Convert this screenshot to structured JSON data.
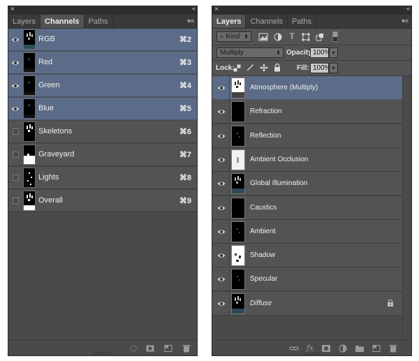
{
  "channels_panel": {
    "close_glyph": "×",
    "collapse_glyph": "«",
    "menu_glyph": "▾≡",
    "tabs": [
      {
        "label": "Layers",
        "active": false
      },
      {
        "label": "Channels",
        "active": true
      },
      {
        "label": "Paths",
        "active": false
      }
    ],
    "rows": [
      {
        "name": "RGB",
        "shortcut": "⌘2",
        "visible": true,
        "selected": true,
        "thumb": "rgb"
      },
      {
        "name": "Red",
        "shortcut": "⌘3",
        "visible": true,
        "selected": true,
        "thumb": "dark"
      },
      {
        "name": "Green",
        "shortcut": "⌘4",
        "visible": true,
        "selected": true,
        "thumb": "dark"
      },
      {
        "name": "Blue",
        "shortcut": "⌘5",
        "visible": true,
        "selected": true,
        "thumb": "dark"
      },
      {
        "name": "Skeletons",
        "shortcut": "⌘6",
        "visible": false,
        "selected": false,
        "thumb": "skeletons"
      },
      {
        "name": "Graveyard",
        "shortcut": "⌘7",
        "visible": false,
        "selected": false,
        "thumb": "graveyard"
      },
      {
        "name": "Lights",
        "shortcut": "⌘8",
        "visible": false,
        "selected": false,
        "thumb": "lights"
      },
      {
        "name": "Overall",
        "shortcut": "⌘9",
        "visible": false,
        "selected": false,
        "thumb": "overall"
      }
    ],
    "bottom_icons": [
      "load-selection-icon",
      "save-selection-icon",
      "new-channel-icon",
      "trash-icon"
    ]
  },
  "layers_panel": {
    "close_glyph": "×",
    "collapse_glyph": "«",
    "menu_glyph": "▾≡",
    "tabs": [
      {
        "label": "Layers",
        "active": true
      },
      {
        "label": "Channels",
        "active": false
      },
      {
        "label": "Paths",
        "active": false
      }
    ],
    "filter": {
      "kind_label": "Kind",
      "search_glyph": "⌕"
    },
    "blend_mode": "Multiply",
    "opacity_label": "Opacity:",
    "opacity_value": "100%",
    "lock_label": "Lock:",
    "fill_label": "Fill:",
    "fill_value": "100%",
    "layers": [
      {
        "name": "Atmosphere (Multiply)",
        "selected": true,
        "thumb": "atmosphere",
        "italic": false,
        "locked": false
      },
      {
        "name": "Refraction",
        "selected": false,
        "thumb": "black",
        "italic": false,
        "locked": false
      },
      {
        "name": "Reflection",
        "selected": false,
        "thumb": "faint",
        "italic": false,
        "locked": false
      },
      {
        "name": "Ambient Occlusion",
        "selected": false,
        "thumb": "white",
        "italic": false,
        "locked": false
      },
      {
        "name": "Global Illumination",
        "selected": false,
        "thumb": "scene",
        "italic": false,
        "locked": false
      },
      {
        "name": "Caustics",
        "selected": false,
        "thumb": "black",
        "italic": false,
        "locked": false
      },
      {
        "name": "Ambient",
        "selected": false,
        "thumb": "faint",
        "italic": false,
        "locked": false
      },
      {
        "name": "Shadow",
        "selected": false,
        "thumb": "shadow",
        "italic": false,
        "locked": false
      },
      {
        "name": "Specular",
        "selected": false,
        "thumb": "faint",
        "italic": false,
        "locked": false
      },
      {
        "name": "Diffuse",
        "selected": false,
        "thumb": "scene",
        "italic": true,
        "locked": true
      }
    ],
    "bottom_icons": [
      "link-icon",
      "fx-icon",
      "mask-icon",
      "adjustment-icon",
      "folder-icon",
      "new-layer-icon",
      "trash-icon"
    ],
    "fx_glyph": "fx"
  }
}
